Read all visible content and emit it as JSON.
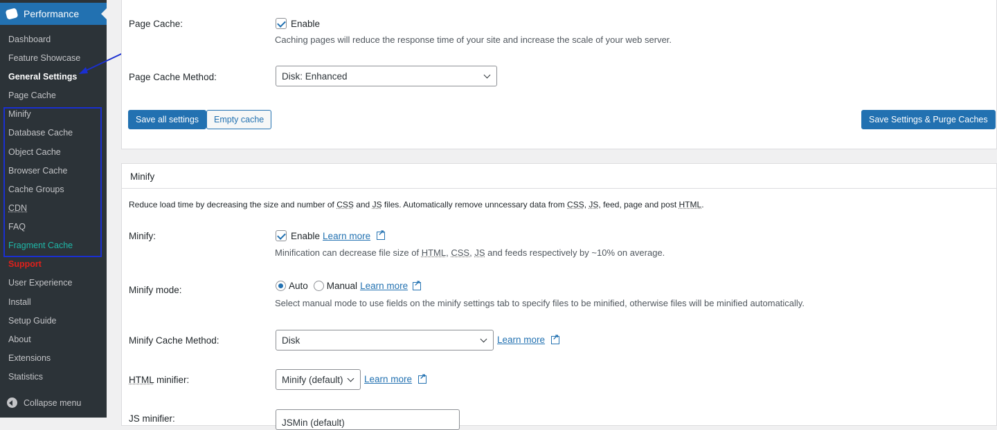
{
  "sidebar": {
    "title": "Performance",
    "items": [
      "Dashboard",
      "Feature Showcase",
      "General Settings",
      "Page Cache",
      "Minify",
      "Database Cache",
      "Object Cache",
      "Browser Cache",
      "Cache Groups",
      "CDN",
      "FAQ",
      "Fragment Cache",
      "Support",
      "User Experience",
      "Install",
      "Setup Guide",
      "About",
      "Extensions",
      "Statistics"
    ],
    "collapse": "Collapse menu"
  },
  "page_cache": {
    "label": "Page Cache:",
    "enable": "Enable",
    "desc": "Caching pages will reduce the response time of your site and increase the scale of your web server.",
    "method_label": "Page Cache Method:",
    "method_value": "Disk: Enhanced",
    "save_all": "Save all settings",
    "empty_cache": "Empty cache",
    "save_purge": "Save Settings & Purge Caches"
  },
  "minify": {
    "title": "Minify",
    "intro": [
      "Reduce load time by decreasing the size and number of ",
      "CSS",
      " and ",
      "JS",
      " files. Automatically remove unncessary data from ",
      "CSS",
      ", ",
      "JS",
      ", feed, page and post ",
      "HTML",
      "."
    ],
    "minify_label": "Minify:",
    "enable": "Enable",
    "learn_more": "Learn more",
    "minify_desc": [
      "Minification can decrease file size of ",
      "HTML",
      ", ",
      "CSS",
      ", ",
      "JS",
      " and feeds respectively by ~10% on average."
    ],
    "mode_label": "Minify mode:",
    "auto": "Auto",
    "manual": "Manual",
    "mode_desc": "Select manual mode to use fields on the minify settings tab to specify files to be minified, otherwise files will be minified automatically.",
    "cache_method_label": "Minify Cache Method:",
    "cache_method_value": "Disk",
    "html_label_abbr": "HTML",
    "html_label_rest": " minifier:",
    "html_value": "Minify (default)",
    "js_label": "JS minifier:",
    "js_value": "JSMin (default)"
  }
}
